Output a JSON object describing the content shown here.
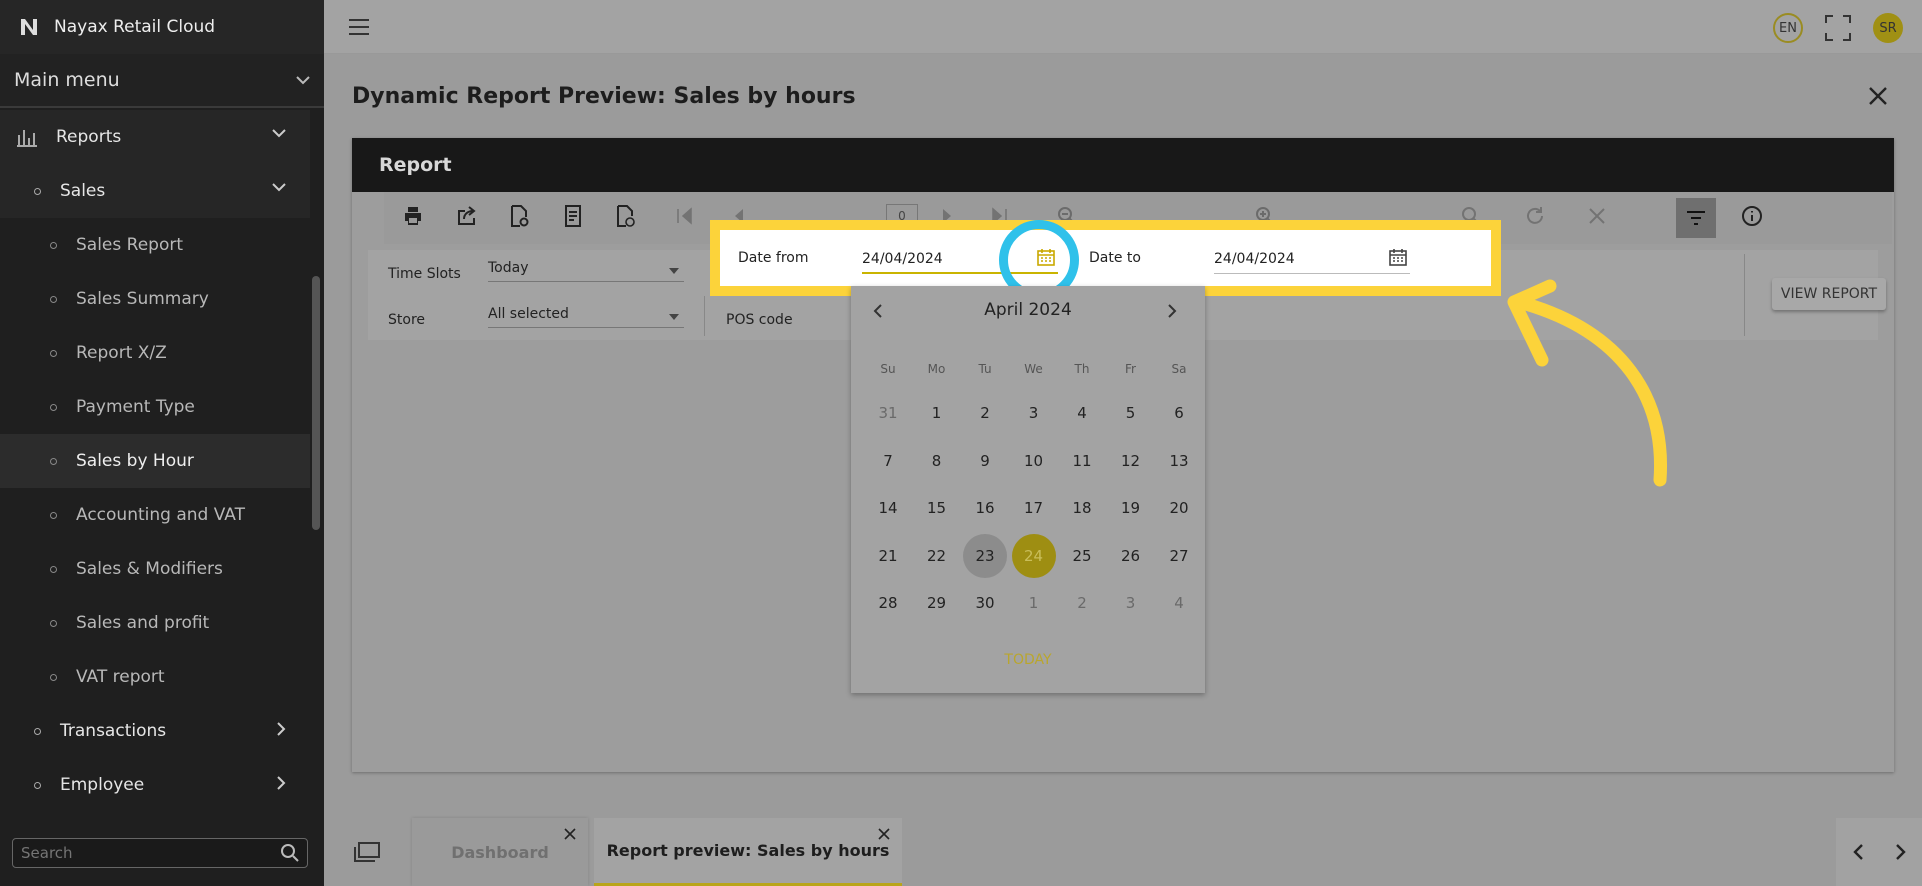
{
  "app": {
    "title": "Nayax Retail Cloud"
  },
  "sidebar": {
    "main_menu": "Main menu",
    "reports": "Reports",
    "sales": "Sales",
    "items": [
      "Sales Report",
      "Sales Summary",
      "Report X/Z",
      "Payment Type",
      "Sales by Hour",
      "Accounting and VAT",
      "Sales & Modifiers",
      "Sales and profit",
      "VAT report"
    ],
    "active_item": "Sales by Hour",
    "transactions": "Transactions",
    "employee": "Employee",
    "search_placeholder": "Search"
  },
  "topbar": {
    "language": "EN",
    "user_initials": "SR"
  },
  "page": {
    "title": "Dynamic Report Preview: Sales by hours"
  },
  "report": {
    "header": "Report",
    "page_number": "0",
    "params": {
      "time_slots_label": "Time Slots",
      "time_slots_value": "Today",
      "store_label": "Store",
      "store_value": "All selected",
      "pos_code_label": "POS code",
      "date_from_label": "Date from",
      "date_from_value": "24/04/2024",
      "date_to_label": "Date to",
      "date_to_value": "24/04/2024",
      "view_report_label": "VIEW REPORT"
    }
  },
  "datepicker": {
    "month_label": "April 2024",
    "weekdays": [
      "Su",
      "Mo",
      "Tu",
      "We",
      "Th",
      "Fr",
      "Sa"
    ],
    "weeks": [
      [
        "31",
        "1",
        "2",
        "3",
        "4",
        "5",
        "6"
      ],
      [
        "7",
        "8",
        "9",
        "10",
        "11",
        "12",
        "13"
      ],
      [
        "14",
        "15",
        "16",
        "17",
        "18",
        "19",
        "20"
      ],
      [
        "21",
        "22",
        "23",
        "24",
        "25",
        "26",
        "27"
      ],
      [
        "28",
        "29",
        "30",
        "1",
        "2",
        "3",
        "4"
      ]
    ],
    "selected_day": "24",
    "hovered_day": "23",
    "today_label": "TODAY"
  },
  "tabs": [
    {
      "label": "Dashboard",
      "active": false
    },
    {
      "label": "Report preview: Sales by hours",
      "active": true
    }
  ],
  "colors": {
    "highlight": "#fcd33a",
    "ring": "#2fc1ea",
    "accent": "#9e8e12"
  }
}
